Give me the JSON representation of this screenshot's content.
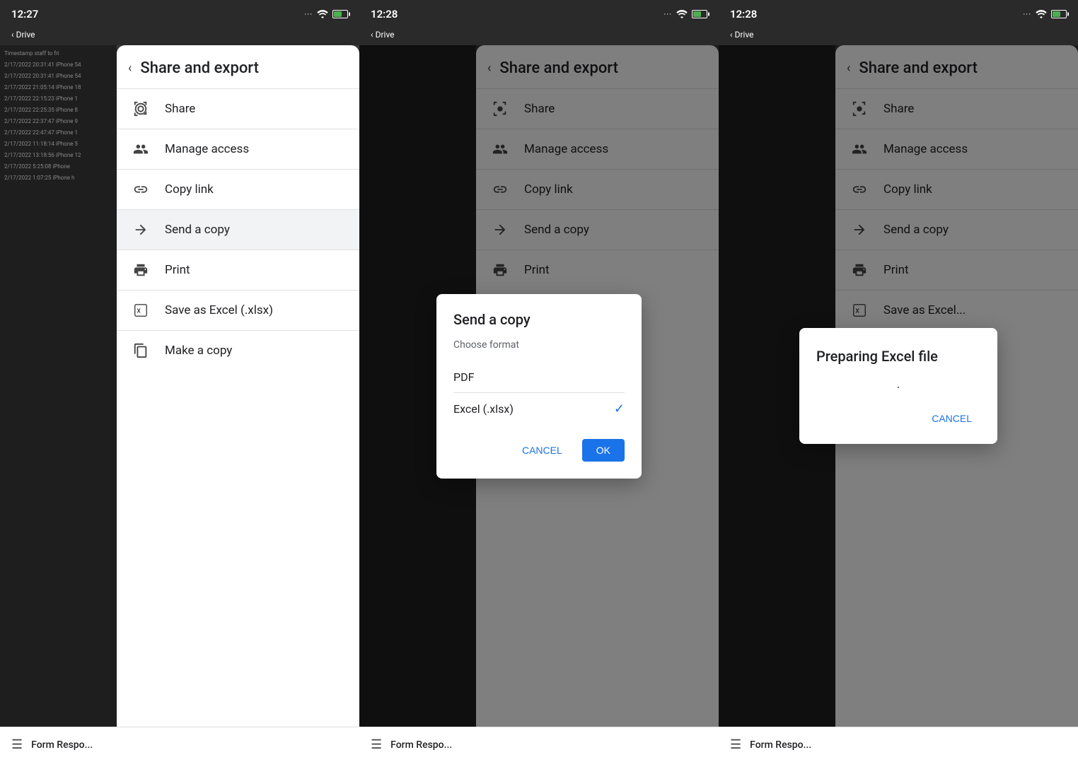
{
  "colors": {
    "accent": "#1a73e8",
    "highlight_bg": "#f1f3f4",
    "text_primary": "#202124",
    "text_secondary": "#5f6368",
    "border": "#e0e0e0",
    "check": "#1a73e8"
  },
  "panels": [
    {
      "id": "panel1",
      "status": {
        "time": "12:27",
        "drive_label": "Drive",
        "back_arrow": "‹"
      },
      "drawer": {
        "title": "Share and export",
        "back_icon": "‹",
        "items": [
          {
            "id": "share",
            "icon": "person_add",
            "label": "Share",
            "highlighted": false
          },
          {
            "id": "manage_access",
            "icon": "group",
            "label": "Manage access",
            "highlighted": false
          },
          {
            "id": "copy_link",
            "icon": "link",
            "label": "Copy link",
            "highlighted": false
          },
          {
            "id": "send_copy",
            "icon": "forward",
            "label": "Send a copy",
            "highlighted": true
          },
          {
            "id": "print",
            "icon": "print",
            "label": "Print",
            "highlighted": false
          },
          {
            "id": "save_excel",
            "icon": "excel",
            "label": "Save as Excel (.xlsx)",
            "highlighted": false
          },
          {
            "id": "make_copy",
            "icon": "copy_doc",
            "label": "Make a copy",
            "highlighted": false
          }
        ]
      },
      "bottom": {
        "icon": "☰",
        "label": "Form Respo..."
      }
    },
    {
      "id": "panel2",
      "status": {
        "time": "12:28",
        "drive_label": "Drive",
        "back_arrow": "‹"
      },
      "drawer": {
        "title": "Share and export",
        "back_icon": "‹",
        "items": [
          {
            "id": "share",
            "label": "Share",
            "highlighted": false
          },
          {
            "id": "manage_access",
            "label": "Manage access",
            "highlighted": false
          },
          {
            "id": "copy_link",
            "label": "Copy link",
            "highlighted": false
          },
          {
            "id": "send_copy",
            "label": "Send a copy",
            "highlighted": false
          },
          {
            "id": "print",
            "label": "Print",
            "highlighted": false
          }
        ]
      },
      "dialog": {
        "title": "Send a copy",
        "subtitle": "Choose format",
        "options": [
          {
            "id": "pdf",
            "label": "PDF",
            "selected": false
          },
          {
            "id": "excel",
            "label": "Excel (.xlsx)",
            "selected": true
          }
        ],
        "cancel_label": "Cancel",
        "ok_label": "OK"
      },
      "bottom": {
        "icon": "☰",
        "label": "Form Respo..."
      }
    },
    {
      "id": "panel3",
      "status": {
        "time": "12:28",
        "drive_label": "Drive",
        "back_arrow": "‹"
      },
      "drawer": {
        "title": "Share and export",
        "back_icon": "‹",
        "items": [
          {
            "id": "share",
            "label": "Share",
            "highlighted": false
          },
          {
            "id": "manage_access",
            "label": "Manage access",
            "highlighted": false
          },
          {
            "id": "copy_link",
            "label": "Copy link",
            "highlighted": false
          },
          {
            "id": "send_copy",
            "label": "Send a copy",
            "highlighted": false
          },
          {
            "id": "print",
            "label": "Print",
            "highlighted": false
          }
        ]
      },
      "dialog": {
        "title": "Preparing Excel file",
        "dot": "·",
        "cancel_label": "Cancel"
      },
      "bottom": {
        "icon": "☰",
        "label": "Form Respo..."
      }
    }
  ],
  "sheet_rows": [
    "Timestamp         staff to fri",
    "2/17/2022 20:31:41   iPhone 54",
    "2/17/2022 20:31:41   iPhone 54",
    "2/17/2022 21:05:14   iPhone 18",
    "2/17/2022 22:15:23   iPhone 1",
    "2/17/2022 22:25:35   iPhone 8",
    "2/17/2022 22:37:47   iPhone 9",
    "2/17/2022 22:47:47   iPhone 1",
    "2/17/2022 11:18:14   iPhone 5",
    "2/17/2022 13:18:56   iPhone 12",
    "2/17/2022 5:25:08    iPhone",
    "2/17/2022 1:07:25    iPhone h"
  ]
}
